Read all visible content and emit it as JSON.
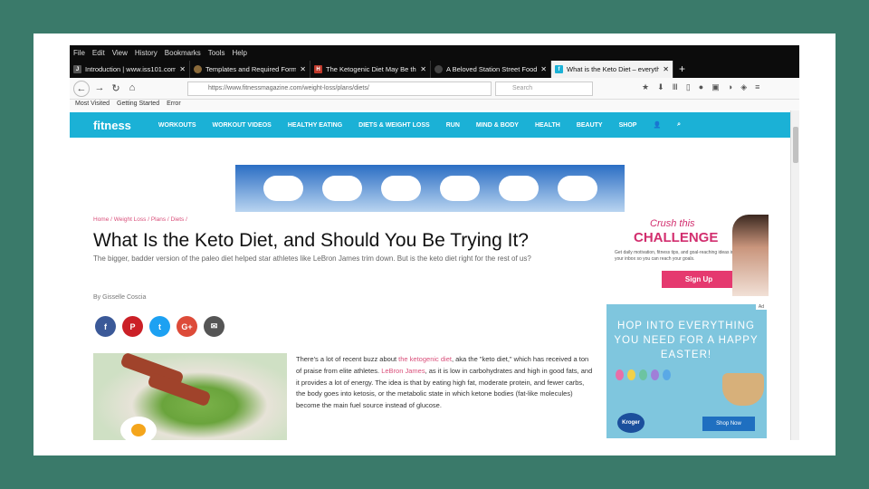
{
  "menu": [
    "File",
    "Edit",
    "View",
    "History",
    "Bookmarks",
    "Tools",
    "Help"
  ],
  "tabs": [
    {
      "title": "Introduction | www.iss101.com",
      "favicon": "J",
      "color": "#555555",
      "active": false
    },
    {
      "title": "Templates and Required Forms",
      "favicon": "",
      "color": "#8a6a3a",
      "active": false
    },
    {
      "title": "The Ketogenic Diet May Be the",
      "favicon": "H",
      "color": "#c0392b",
      "active": false
    },
    {
      "title": "A Beloved Station Street Food",
      "favicon": "",
      "color": "#444444",
      "active": false
    },
    {
      "title": "What is the Keto Diet – everyth",
      "favicon": "f",
      "color": "#1bb1d6",
      "active": true
    }
  ],
  "url": "https://www.fitnessmagazine.com/weight-loss/plans/diets/",
  "search_placeholder": "Search",
  "bookmarks": [
    "Most Visited",
    "Getting Started",
    "Error"
  ],
  "site": {
    "logo": "fitness",
    "nav": [
      "WORKOUTS",
      "WORKOUT VIDEOS",
      "HEALTHY EATING",
      "DIETS & WEIGHT LOSS",
      "RUN",
      "MIND & BODY",
      "HEALTH",
      "BEAUTY",
      "SHOP"
    ]
  },
  "breadcrumb": "Home / Weight Loss / Plans / Diets /",
  "title": "What Is the Keto Diet, and Should You Be Trying It?",
  "subtitle": "The bigger, badder version of the paleo diet helped star athletes like LeBron James trim down. But is the keto diet right for the rest of us?",
  "byline": "By Gisselle Coscia",
  "share": [
    {
      "name": "facebook",
      "glyph": "f",
      "color": "#3b5998"
    },
    {
      "name": "pinterest",
      "glyph": "P",
      "color": "#cb2027"
    },
    {
      "name": "twitter",
      "glyph": "t",
      "color": "#1da1f2"
    },
    {
      "name": "googleplus",
      "glyph": "G+",
      "color": "#dd4b39"
    },
    {
      "name": "email",
      "glyph": "✉",
      "color": "#555555"
    }
  ],
  "article": {
    "p1": "There's a lot of recent buzz about ",
    "link1": "the ketogenic diet",
    "p2": ", aka the \"keto diet,\" which has received a ton of praise from elite athletes. ",
    "link2": "LeBron James",
    "p3": ", as it is low in carbohydrates and high in good fats, and it provides a lot of energy. The idea is that by eating high fat, moderate protein, and fewer carbs, the body goes into ketosis, or the metabolic state in which ketone bodies (fat-like molecules) become the main fuel source instead of glucose."
  },
  "promo": {
    "crush": "Crush this",
    "challenge": "CHALLENGE",
    "text": "Get daily motivation, fitness tips, and goal-reaching ideas in your inbox so you can reach your goals.",
    "button": "Sign Up"
  },
  "ad": {
    "badge": "Ad",
    "headline": "HOP INTO EVERYTHING YOU NEED FOR A HAPPY EASTER!",
    "brand": "Kroger",
    "cta": "Shop Now"
  }
}
